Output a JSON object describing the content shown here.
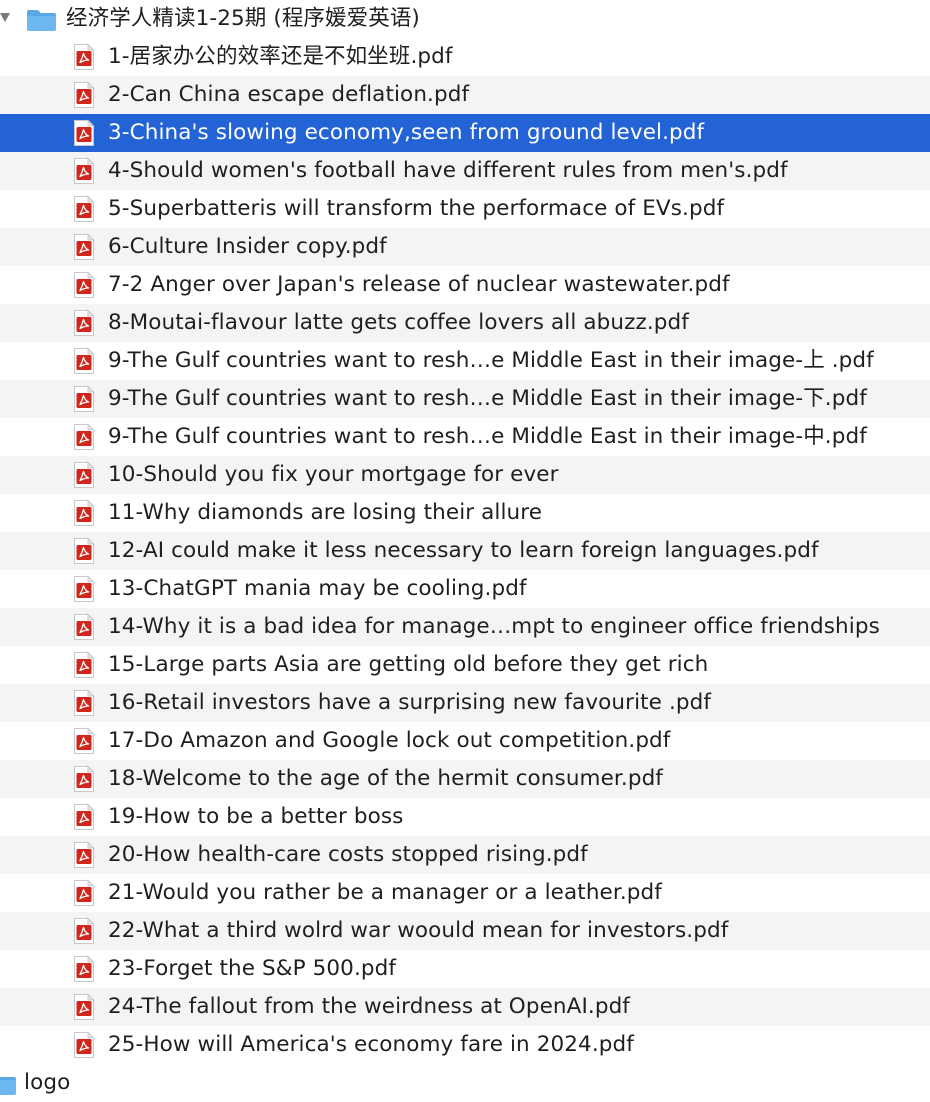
{
  "folder": {
    "name": "经济学人精读1-25期 (程序媛爱英语)",
    "icon": "folder-icon",
    "expanded": true,
    "color": "#5aa9e6"
  },
  "files": [
    {
      "name": "1-居家办公的效率还是不如坐班.pdf",
      "icon": "pdf-icon"
    },
    {
      "name": "2-Can China escape deflation.pdf",
      "icon": "pdf-icon"
    },
    {
      "name": "3-China's slowing economy,seen from ground level.pdf",
      "icon": "pdf-icon",
      "selected": true
    },
    {
      "name": "4-Should women's football have different rules from men's.pdf",
      "icon": "pdf-icon"
    },
    {
      "name": "5-Superbatteris will transform the performace of EVs.pdf",
      "icon": "pdf-icon"
    },
    {
      "name": "6-Culture Insider copy.pdf",
      "icon": "pdf-icon"
    },
    {
      "name": "7-2 Anger over Japan's release of nuclear wastewater.pdf",
      "icon": "pdf-icon"
    },
    {
      "name": "8-Moutai-flavour latte gets coffee lovers all abuzz.pdf",
      "icon": "pdf-icon"
    },
    {
      "name": "9-The Gulf countries want to resh…e Middle East in their image-上 .pdf",
      "icon": "pdf-icon"
    },
    {
      "name": "9-The Gulf countries want to resh…e Middle East in their image-下.pdf",
      "icon": "pdf-icon"
    },
    {
      "name": "9-The Gulf countries want to resh…e Middle East in their image-中.pdf",
      "icon": "pdf-icon"
    },
    {
      "name": "10-Should you fix your mortgage for ever",
      "icon": "pdf-icon"
    },
    {
      "name": "11-Why diamonds are losing their allure",
      "icon": "pdf-icon"
    },
    {
      "name": "12-AI could make it less necessary to learn foreign languages.pdf",
      "icon": "pdf-icon"
    },
    {
      "name": "13-ChatGPT mania may be cooling.pdf",
      "icon": "pdf-icon"
    },
    {
      "name": "14-Why it is a bad idea for manage…mpt to engineer office friendships",
      "icon": "pdf-icon"
    },
    {
      "name": "15-Large parts Asia are getting old before they get rich",
      "icon": "pdf-icon"
    },
    {
      "name": "16-Retail investors have a surprising new favourite .pdf",
      "icon": "pdf-icon"
    },
    {
      "name": "17-Do Amazon and Google lock out competition.pdf",
      "icon": "pdf-icon"
    },
    {
      "name": "18-Welcome to the age of the hermit consumer.pdf",
      "icon": "pdf-icon"
    },
    {
      "name": "19-How to be a better boss",
      "icon": "pdf-icon"
    },
    {
      "name": "20-How health-care costs stopped rising.pdf",
      "icon": "pdf-icon"
    },
    {
      "name": "21-Would you rather be a manager or a leather.pdf",
      "icon": "pdf-icon"
    },
    {
      "name": "22-What a third wolrd war woould mean for investors.pdf",
      "icon": "pdf-icon"
    },
    {
      "name": "23-Forget the S&P 500.pdf",
      "icon": "pdf-icon"
    },
    {
      "name": "24-The fallout from the weirdness at OpenAI.pdf",
      "icon": "pdf-icon"
    },
    {
      "name": "25-How will America's economy fare in 2024.pdf",
      "icon": "pdf-icon"
    }
  ],
  "next_folder": {
    "name": "logo",
    "icon": "folder-icon"
  },
  "colors": {
    "selection": "#2463d6",
    "stripe": "#f4f4f4",
    "pdf_red": "#d0261d"
  }
}
